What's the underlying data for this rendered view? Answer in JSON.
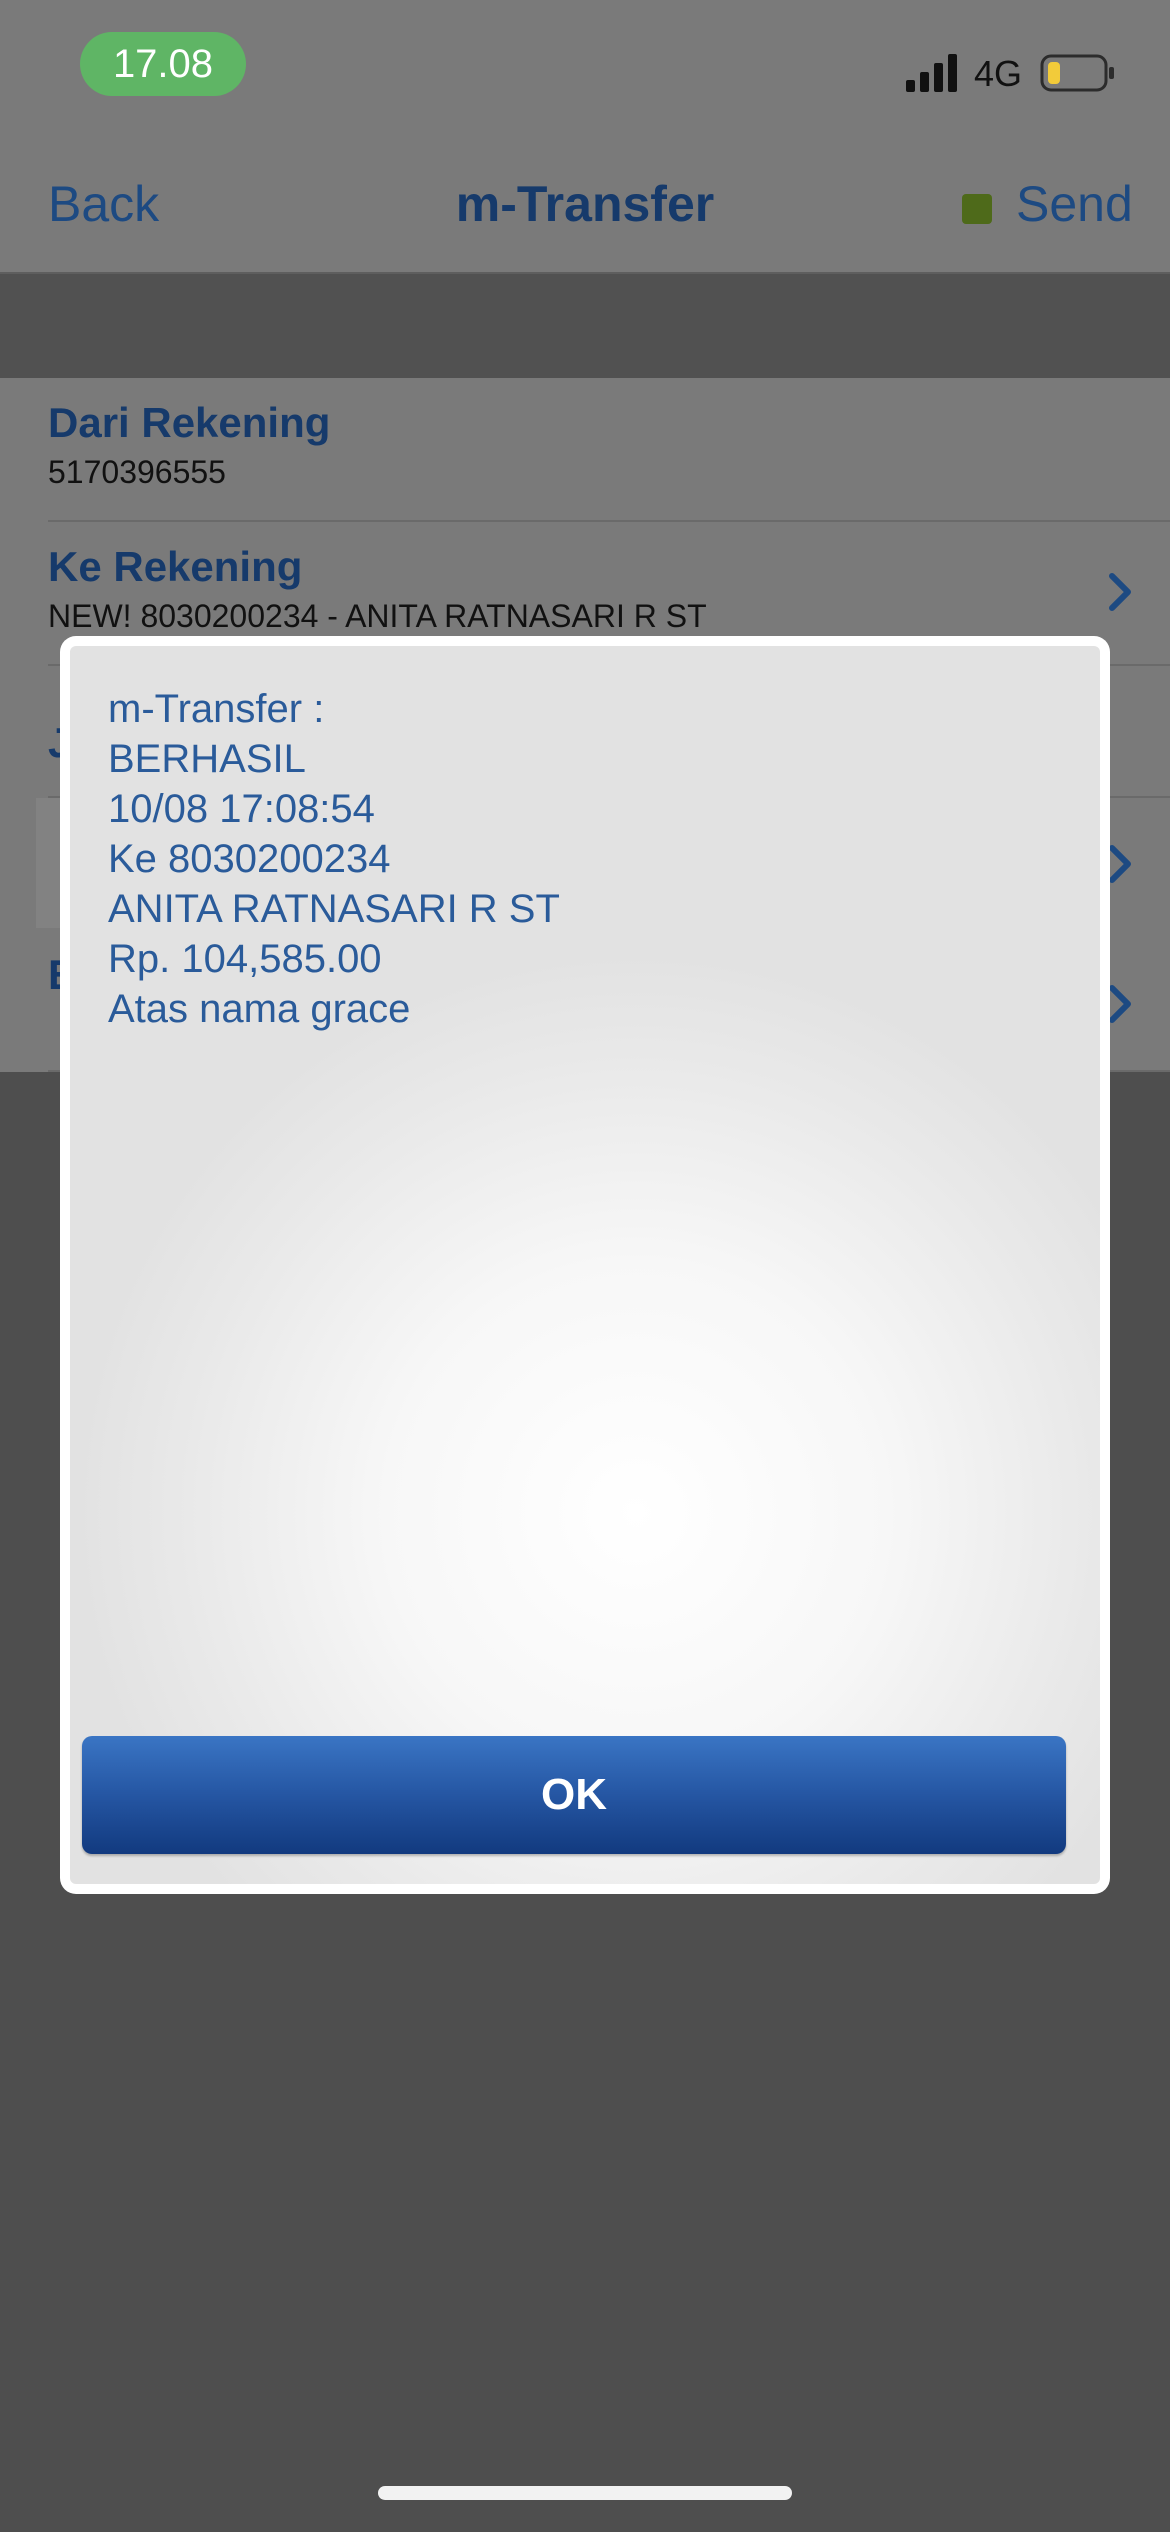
{
  "status_bar": {
    "time": "17.08",
    "network": "4G",
    "signal_icon": "signal-bars-icon",
    "battery_icon": "battery-low-icon"
  },
  "nav": {
    "back_label": "Back",
    "title": "m-Transfer",
    "send_label": "Send"
  },
  "form": {
    "from_label": "Dari Rekening",
    "from_value": "5170396555",
    "to_label": "Ke Rekening",
    "to_value": "NEW! 8030200234 - ANITA RATNASARI R ST",
    "row3_partial": "J",
    "row5_partial": "E"
  },
  "modal": {
    "lines": [
      "m-Transfer :",
      "BERHASIL",
      "10/08 17:08:54",
      "Ke 8030200234",
      "ANITA RATNASARI R ST",
      "Rp. 104,585.00",
      "Atas nama grace"
    ],
    "ok_label": "OK"
  },
  "colors": {
    "accent": "#1d4a82",
    "button_blue": "#2556a3",
    "time_pill": "#5fb565"
  }
}
